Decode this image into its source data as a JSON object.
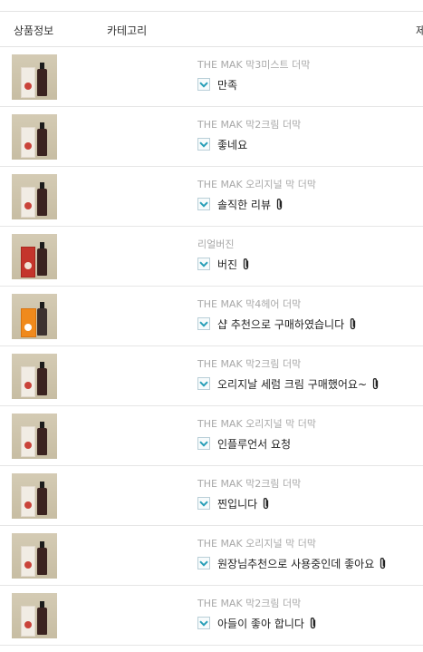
{
  "header": {
    "product_label": "상품정보",
    "category_label": "카테고리",
    "cut_label": "제"
  },
  "rows": [
    {
      "category": "THE MAK 막3미스트 더막",
      "subject": "만족",
      "attachment": false,
      "thumb": "white-box"
    },
    {
      "category": "THE MAK 막2크림 더막",
      "subject": "좋네요",
      "attachment": false,
      "thumb": "white-box"
    },
    {
      "category": "THE MAK 오리지널 막 더막",
      "subject": "솔직한 리뷰",
      "attachment": true,
      "thumb": "white-box"
    },
    {
      "category": "리얼버진",
      "subject": "버진",
      "attachment": true,
      "thumb": "red-box"
    },
    {
      "category": "THE MAK 막4헤어 더막",
      "subject": "샵 추천으로 구매하였습니다",
      "attachment": true,
      "thumb": "orange-box"
    },
    {
      "category": "THE MAK 막2크림 더막",
      "subject": "오리지날 세럼 크림 구매했어요~",
      "attachment": true,
      "thumb": "white-box"
    },
    {
      "category": "THE MAK 오리지널 막 더막",
      "subject": "인플루언서 요청",
      "attachment": false,
      "thumb": "white-box"
    },
    {
      "category": "THE MAK 막2크림 더막",
      "subject": "찐입니다",
      "attachment": true,
      "thumb": "white-box"
    },
    {
      "category": "THE MAK 오리지널 막 더막",
      "subject": "원장님추천으로 사용중인데 좋아요",
      "attachment": true,
      "thumb": "white-box"
    },
    {
      "category": "THE MAK 막2크림 더막",
      "subject": "아들이 좋아 합니다",
      "attachment": true,
      "thumb": "white-box"
    }
  ],
  "icons": {
    "expand": "chevron-down-icon",
    "attachment": "paperclip-icon"
  },
  "colors": {
    "toggle_arrow": "#2a9fb8",
    "category_text": "#a8a8a8"
  }
}
